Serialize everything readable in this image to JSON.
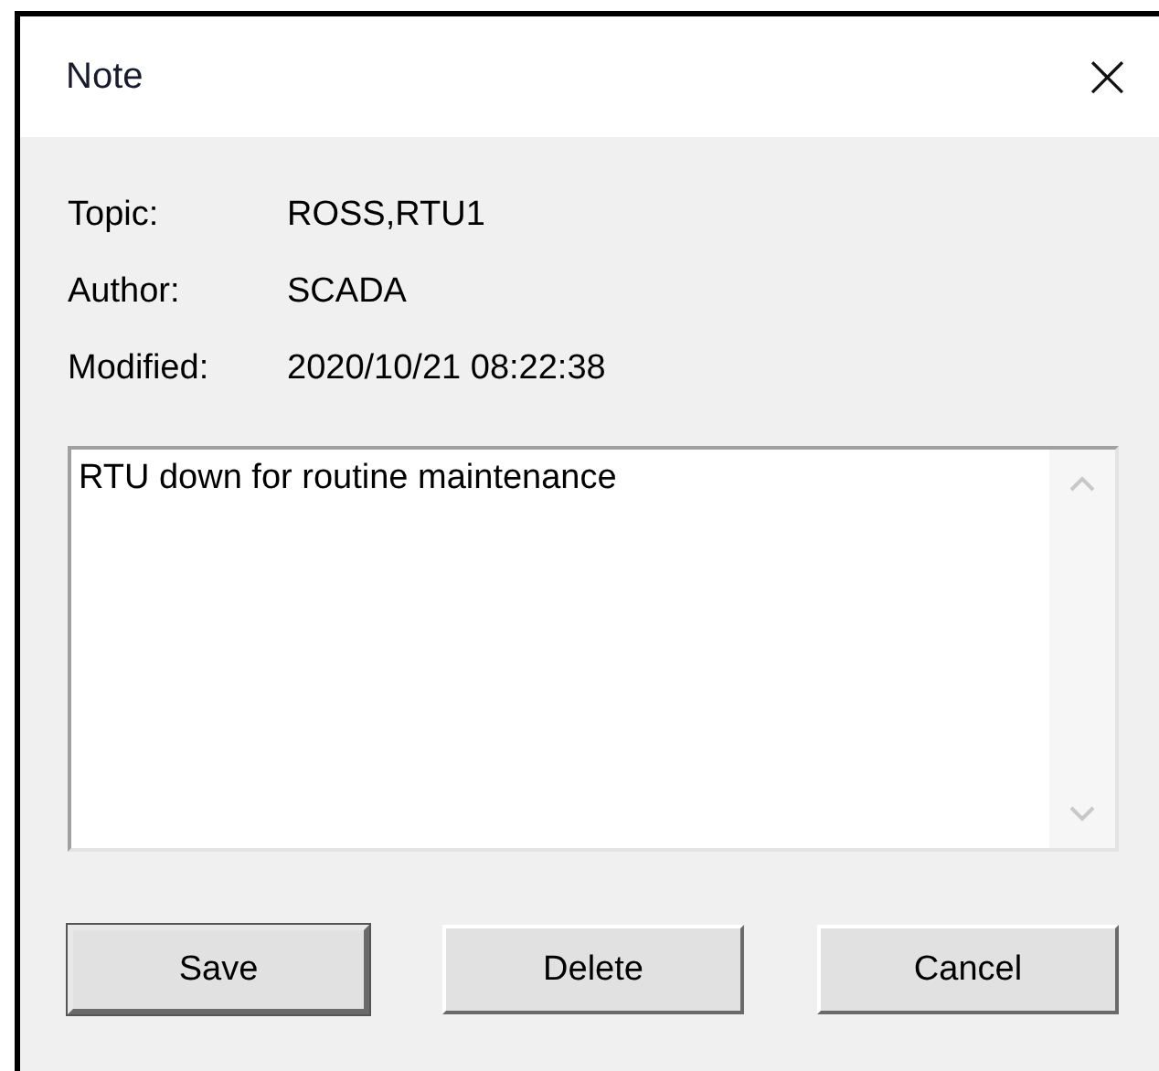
{
  "window": {
    "title": "Note",
    "close": "×"
  },
  "fields": [
    {
      "label": "Topic:",
      "value": "ROSS,RTU1"
    },
    {
      "label": "Author:",
      "value": "SCADA"
    },
    {
      "label": "Modified:",
      "value": "2020/10/21 08:22:38"
    }
  ],
  "note": {
    "value": "RTU down for routine maintenance"
  },
  "buttons": [
    {
      "label": "Save",
      "default": true
    },
    {
      "label": "Delete",
      "default": false
    },
    {
      "label": "Cancel",
      "default": false
    }
  ]
}
